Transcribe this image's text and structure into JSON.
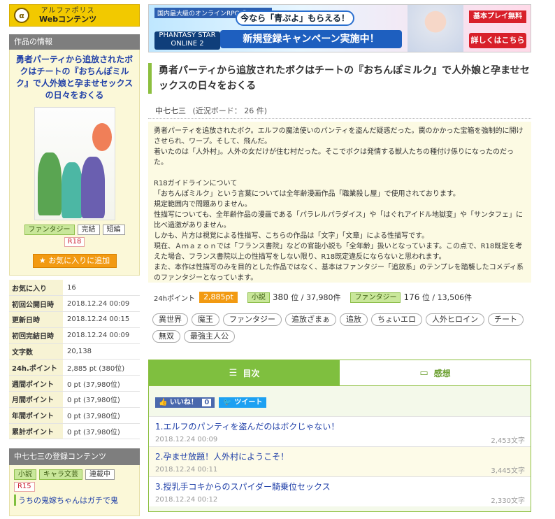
{
  "logo": {
    "line1": "アルファポリス",
    "line2": "Webコンテンツ"
  },
  "sidebar": {
    "info_heading": "作品の情報",
    "work_title": "勇者パーティから追放されたボクはチートの『おちんぽミルク』で人外娘と孕ませセックスの日々をおくる",
    "cover_text": "勇者パーティから追放されたボクはチートの『おちんぽミルク』で人外娘と孕ませセックスの日々をおくる",
    "genre_tag": "ファンタジー",
    "status_tags": [
      "完結",
      "短編"
    ],
    "rating_tag": "R18",
    "favorite_button": "お気に入りに追加",
    "stats": [
      {
        "label": "お気に入り",
        "value": "16"
      },
      {
        "label": "初回公開日時",
        "value": "2018.12.24 00:09"
      },
      {
        "label": "更新日時",
        "value": "2018.12.24 00:15"
      },
      {
        "label": "初回完結日時",
        "value": "2018.12.24 00:09"
      },
      {
        "label": "文字数",
        "value": "20,138"
      },
      {
        "label": "24h.ポイント",
        "value": "2,885 pt (380位)"
      },
      {
        "label": "週間ポイント",
        "value": "0 pt (37,980位)"
      },
      {
        "label": "月間ポイント",
        "value": "0 pt (37,980位)"
      },
      {
        "label": "年間ポイント",
        "value": "0 pt (37,980位)"
      },
      {
        "label": "累計ポイント",
        "value": "0 pt (37,980位)"
      }
    ],
    "registered_heading": "中七七三の登録コンテンツ",
    "registered_tags": [
      "小説",
      "キャラ文芸",
      "連載中"
    ],
    "registered_rating": "R15",
    "registered_link": "うちの鬼嫁ちゃんはガチで鬼"
  },
  "banner": {
    "top_label": "国内最大級のオンラインRPG「PSO2」",
    "game_logo": "PHANTASY STAR ONLINE 2",
    "now_text": "今なら「青ぷよ」もらえる！",
    "campaign_text": "新規登録キャンペーン実施中！",
    "free_text": "基本プレイ無料",
    "detail_text": "詳しくはこちら"
  },
  "work": {
    "title": "勇者パーティから追放されたボクはチートの『おちんぽミルク』で人外娘と孕ませセックスの日々をおくる",
    "author": "中七七三",
    "board": "(近況ボード： 26 件)",
    "synopsis": "勇者パーティを追放されたボク。エルフの魔法使いのパンティを盗んだ疑惑だった。罠のかかった宝箱を強制的に開けさせられ、ワープ。そして、飛んだ。\n着いたのは「人外村」。人外の女だけが住む村だった。そこでボクは発情する獣人たちの種付け係りになったのだった。\n\nR18ガイドラインについて\n「おちんぽミルク」という言葉については全年齢漫画作品「職業殺し屋」で使用されております。\n規定範囲内で問題ありません。\n性描写についても、全年齢作品の漫画である「パラレルパラダイス」や「はぐれアイドル地獄変」や「サンタフェ」に比べ過激がありません。\nしかも、片方は視覚による性描写、こちらの作品は「文字」「文章」による性描写です。\n現在、Ａｍａｚｏｎでは「フランス書院」などの官能小説も「全年齢」扱いとなっています。この点で、R18既定を考えた場合、フランス書院以上の性描写をしない限り、R18既定違反にならないと思われます。\nまた、本作は性描写のみを目的とした作品ではなく、基本はファンタジー「追放系」のテンプレを踏襲したコメディ系のファンタジーとなっています。",
    "points_label": "24hポイント",
    "points_value": "2,885pt",
    "rank1_tag": "小説",
    "rank1_value": "380",
    "rank1_suffix": "位 / 37,980件",
    "rank2_tag": "ファンタジー",
    "rank2_value": "176",
    "rank2_suffix": "位 / 13,506件",
    "keywords": [
      "異世界",
      "魔王",
      "ファンタジー",
      "追放ざまぁ",
      "追放",
      "ちょいエロ",
      "人外ヒロイン",
      "チート",
      "無双",
      "最強主人公"
    ]
  },
  "tabs": {
    "toc": "目次",
    "comments": "感想"
  },
  "social": {
    "like": "いいね！",
    "like_count": "0",
    "tweet": "ツイート"
  },
  "chapters": [
    {
      "title": "1.エルフのパンティを盗んだのはボクじゃない！",
      "date": "2018.12.24 00:09",
      "chars": "2,453文字"
    },
    {
      "title": "2.孕ませ放題！人外村にようこそ！",
      "date": "2018.12.24 00:11",
      "chars": "3,445文字"
    },
    {
      "title": "3.授乳手コキからのスパイダー騎乗位セックス",
      "date": "2018.12.24 00:12",
      "chars": "2,330文字"
    }
  ]
}
